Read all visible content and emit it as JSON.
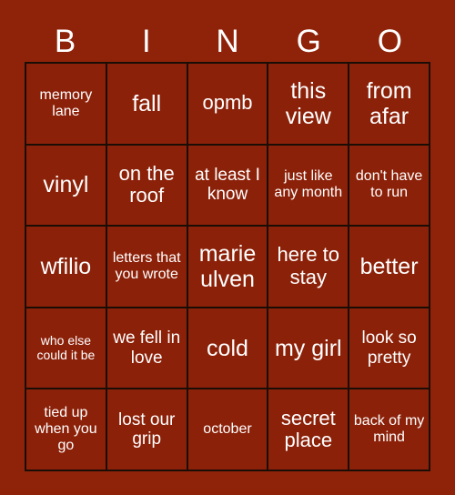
{
  "card": {
    "header_letters": [
      "B",
      "I",
      "N",
      "G",
      "O"
    ],
    "colors": {
      "page_background": "#8f2309",
      "cell_background": "#8c2109",
      "border": "#1a0d06",
      "text": "#ffffff"
    },
    "rows": [
      [
        {
          "text": "memory lane",
          "size": "size-sm"
        },
        {
          "text": "fall",
          "size": "size-xl"
        },
        {
          "text": "opmb",
          "size": "size-lg"
        },
        {
          "text": "this view",
          "size": "size-xl"
        },
        {
          "text": "from afar",
          "size": "size-xl"
        }
      ],
      [
        {
          "text": "vinyl",
          "size": "size-xl"
        },
        {
          "text": "on the roof",
          "size": "size-lg"
        },
        {
          "text": "at least I know",
          "size": "size-md"
        },
        {
          "text": "just like any month",
          "size": "size-sm"
        },
        {
          "text": "don't have to run",
          "size": "size-sm"
        }
      ],
      [
        {
          "text": "wfilio",
          "size": "size-xl"
        },
        {
          "text": "letters that you wrote",
          "size": "size-sm"
        },
        {
          "text": "marie ulven",
          "size": "size-xl"
        },
        {
          "text": "here to stay",
          "size": "size-lg"
        },
        {
          "text": "better",
          "size": "size-xl"
        }
      ],
      [
        {
          "text": "who else could it be",
          "size": "size-xs"
        },
        {
          "text": "we fell in love",
          "size": "size-md"
        },
        {
          "text": "cold",
          "size": "size-xl"
        },
        {
          "text": "my girl",
          "size": "size-xl"
        },
        {
          "text": "look so pretty",
          "size": "size-md"
        }
      ],
      [
        {
          "text": "tied up when you go",
          "size": "size-sm"
        },
        {
          "text": "lost our grip",
          "size": "size-md"
        },
        {
          "text": "october",
          "size": "size-sm"
        },
        {
          "text": "secret place",
          "size": "size-lg"
        },
        {
          "text": "back of my mind",
          "size": "size-sm"
        }
      ]
    ]
  }
}
